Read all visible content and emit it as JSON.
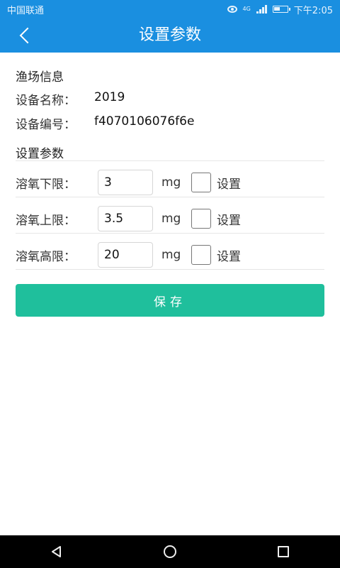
{
  "status_bar": {
    "carrier": "中国联通",
    "network": "4G",
    "time": "下午2:05"
  },
  "app_bar": {
    "title": "设置参数"
  },
  "fishery_info": {
    "section_title": "渔场信息",
    "device_name_label": "设备名称：",
    "device_name_value": "2019",
    "device_id_label": "设备编号：",
    "device_id_value": "f4070106076f6e"
  },
  "settings": {
    "section_title": "设置参数",
    "rows": [
      {
        "label": "溶氧下限：",
        "value": "3",
        "unit": "mg",
        "check_label": "设置",
        "checked": false
      },
      {
        "label": "溶氧上限：",
        "value": "3.5",
        "unit": "mg",
        "check_label": "设置",
        "checked": false
      },
      {
        "label": "溶氧高限：",
        "value": "20",
        "unit": "mg",
        "check_label": "设置",
        "checked": false
      }
    ]
  },
  "save_button": {
    "label": "保存"
  },
  "colors": {
    "primary": "#1a8fe0",
    "accent": "#1fbf9c"
  },
  "icons": {
    "back": "chevron-left-icon",
    "nav_back": "triangle-back-icon",
    "nav_home": "circle-home-icon",
    "nav_recent": "square-recent-icon"
  }
}
